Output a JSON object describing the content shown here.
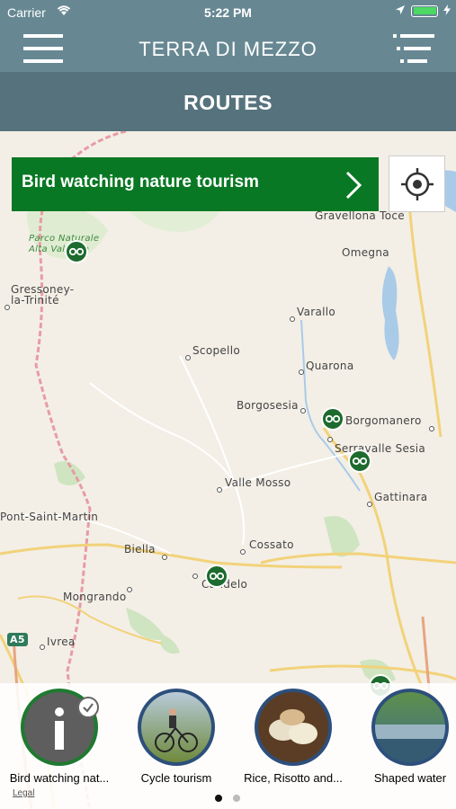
{
  "status": {
    "carrier": "Carrier",
    "time": "5:22 PM"
  },
  "nav": {
    "title": "TERRA DI MEZZO"
  },
  "subbar": {
    "title": "ROUTES"
  },
  "banner": {
    "label": "Bird watching nature tourism"
  },
  "map": {
    "places": [
      "Parco Naturale",
      "Alta Valsesia",
      "Gravellona Toce",
      "Omegna",
      "Gressoney-",
      "la-Trinité",
      "Varallo",
      "Scopello",
      "Quarona",
      "Borgosesia",
      "Borgomanero",
      "Serravalle Sesia",
      "Valle Mosso",
      "Gattinara",
      "Pont-Saint-Martin",
      "Biella",
      "Cossato",
      "Candelo",
      "Mongrando",
      "Ivrea",
      "A5"
    ],
    "legal": "Legal"
  },
  "carousel": {
    "items": [
      {
        "label": "Bird watching nat...",
        "icon": "info-icon"
      },
      {
        "label": "Cycle tourism",
        "icon": "cyclist-photo"
      },
      {
        "label": "Rice, Risotto and...",
        "icon": "rice-photo"
      },
      {
        "label": "Shaped water",
        "icon": "water-photo"
      }
    ],
    "page_count": 2,
    "active_page": 1
  },
  "colors": {
    "nav": "#678893",
    "subbar": "#56737d",
    "route_green": "#097824",
    "marker": "#1d6b2e"
  }
}
